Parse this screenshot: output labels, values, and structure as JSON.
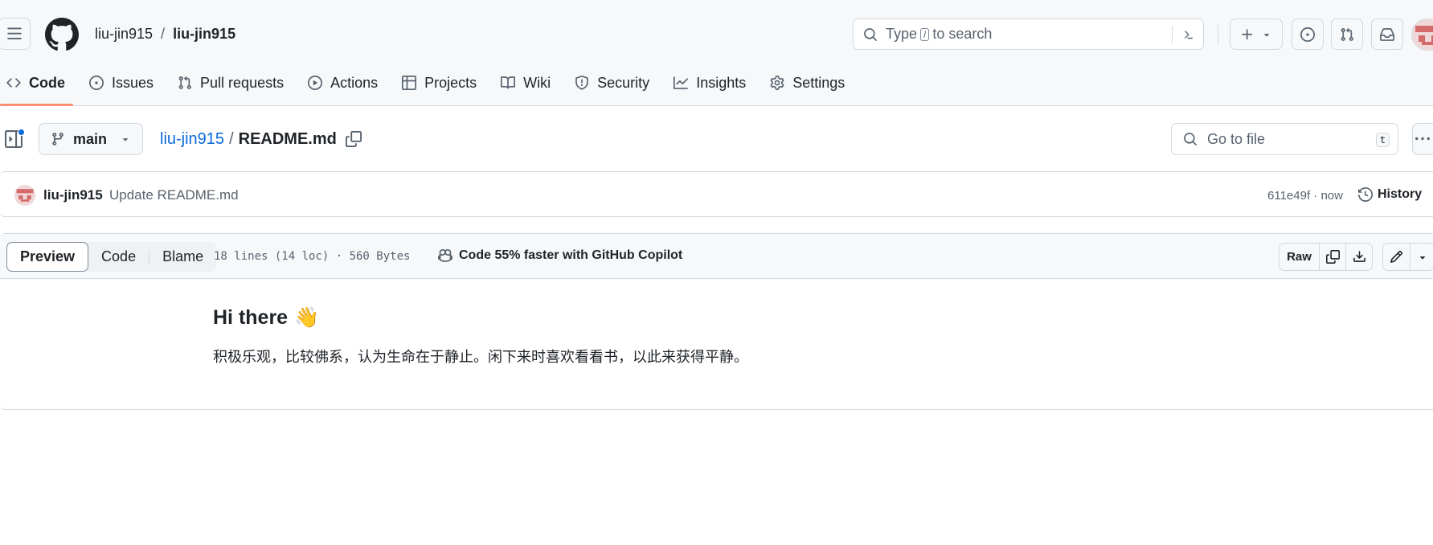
{
  "header": {
    "owner": "liu-jin915",
    "separator": "/",
    "repo": "liu-jin915",
    "search": {
      "prefix": "Type",
      "key": "/",
      "suffix": "to search"
    }
  },
  "nav": [
    {
      "label": "Code",
      "icon": "code-icon",
      "active": true
    },
    {
      "label": "Issues",
      "icon": "issue-opened-icon"
    },
    {
      "label": "Pull requests",
      "icon": "git-pull-request-icon"
    },
    {
      "label": "Actions",
      "icon": "play-icon"
    },
    {
      "label": "Projects",
      "icon": "table-icon"
    },
    {
      "label": "Wiki",
      "icon": "book-icon"
    },
    {
      "label": "Security",
      "icon": "shield-icon"
    },
    {
      "label": "Insights",
      "icon": "graph-icon"
    },
    {
      "label": "Settings",
      "icon": "gear-icon"
    }
  ],
  "file_bar": {
    "branch": "main",
    "path_link": "liu-jin915",
    "path_sep": "/",
    "file_name": "README.md",
    "goto_placeholder": "Go to file",
    "goto_key": "t"
  },
  "commit": {
    "author": "liu-jin915",
    "message": "Update README.md",
    "meta": "611e49f · now",
    "history_label": "History"
  },
  "viewer": {
    "tabs": [
      "Preview",
      "Code",
      "Blame"
    ],
    "selected_tab": "Preview",
    "file_info": "18 lines (14 loc) · 560 Bytes",
    "copilot_text": "Code 55% faster with GitHub Copilot",
    "raw_label": "Raw"
  },
  "readme": {
    "heading": "Hi there",
    "heading_emoji": "👋",
    "paragraph": "积极乐观，比较佛系，认为生命在于静止。闲下来时喜欢看看书，以此来获得平静。"
  },
  "colors": {
    "accent_link": "#0969da",
    "active_tab_underline": "#fd8c73",
    "border": "#d1d9e0",
    "muted_text": "#59636e"
  }
}
